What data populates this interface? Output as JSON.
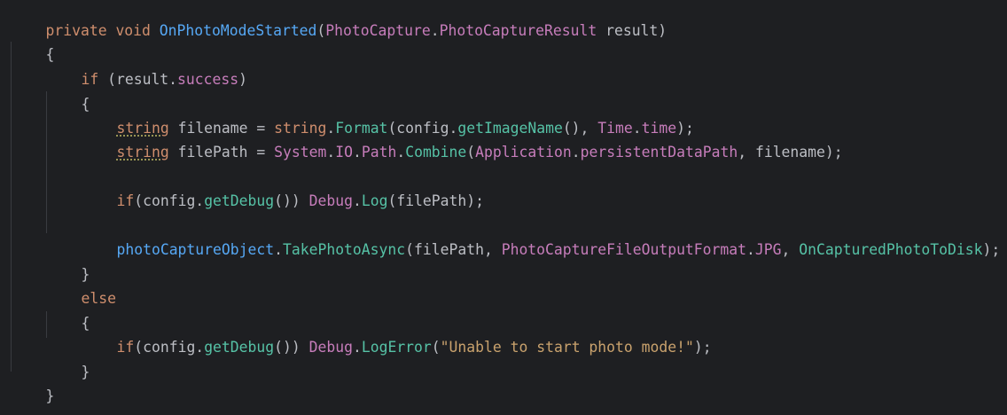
{
  "lines": [
    {
      "id": "l1",
      "tokens": [
        "private",
        " ",
        "void",
        " ",
        "OnPhotoModeStarted",
        "(",
        "PhotoCapture",
        ".",
        "PhotoCaptureResult",
        " result)"
      ]
    },
    {
      "id": "l2",
      "tokens": [
        "{"
      ]
    },
    {
      "id": "l3",
      "tokens": [
        "if",
        " (result.",
        "success",
        ")"
      ]
    },
    {
      "id": "l4",
      "tokens": [
        "{"
      ]
    },
    {
      "id": "l5",
      "tokens": [
        "string",
        " filename = ",
        "string",
        ".",
        "Format",
        "(config.",
        "getImageName",
        "(), ",
        "Time",
        ".",
        "time",
        ");"
      ]
    },
    {
      "id": "l6",
      "tokens": [
        "string",
        " filePath = ",
        "System",
        ".",
        "IO",
        ".",
        "Path",
        ".",
        "Combine",
        "(",
        "Application",
        ".",
        "persistentDataPath",
        ", filename);"
      ]
    },
    {
      "id": "l7",
      "tokens": [
        "if",
        "(config.",
        "getDebug",
        "()) ",
        "Debug",
        ".",
        "Log",
        "(filePath);"
      ]
    },
    {
      "id": "l8",
      "tokens": [
        "photoCaptureObject",
        ".",
        "TakePhotoAsync",
        "(filePath, ",
        "PhotoCaptureFileOutputFormat",
        ".",
        "JPG",
        ", ",
        "OnCapturedPhotoToDisk",
        ");"
      ]
    },
    {
      "id": "l9",
      "tokens": [
        "}"
      ]
    },
    {
      "id": "l10",
      "tokens": [
        "else"
      ]
    },
    {
      "id": "l11",
      "tokens": [
        "{"
      ]
    },
    {
      "id": "l12",
      "tokens": [
        "if",
        "(config.",
        "getDebug",
        "()) ",
        "Debug",
        ".",
        "LogError",
        "(",
        "\"Unable to start photo mode!\"",
        ");"
      ]
    },
    {
      "id": "l13",
      "tokens": [
        "}"
      ]
    },
    {
      "id": "l14",
      "tokens": [
        "}"
      ]
    }
  ],
  "colors": {
    "background": "#1e1f22",
    "keyword": "#cf8e6d",
    "control": "#7a9ee8",
    "method": "#56a8f5",
    "type": "#c77dbb",
    "string": "#6aab73",
    "default": "#bcbec4"
  }
}
